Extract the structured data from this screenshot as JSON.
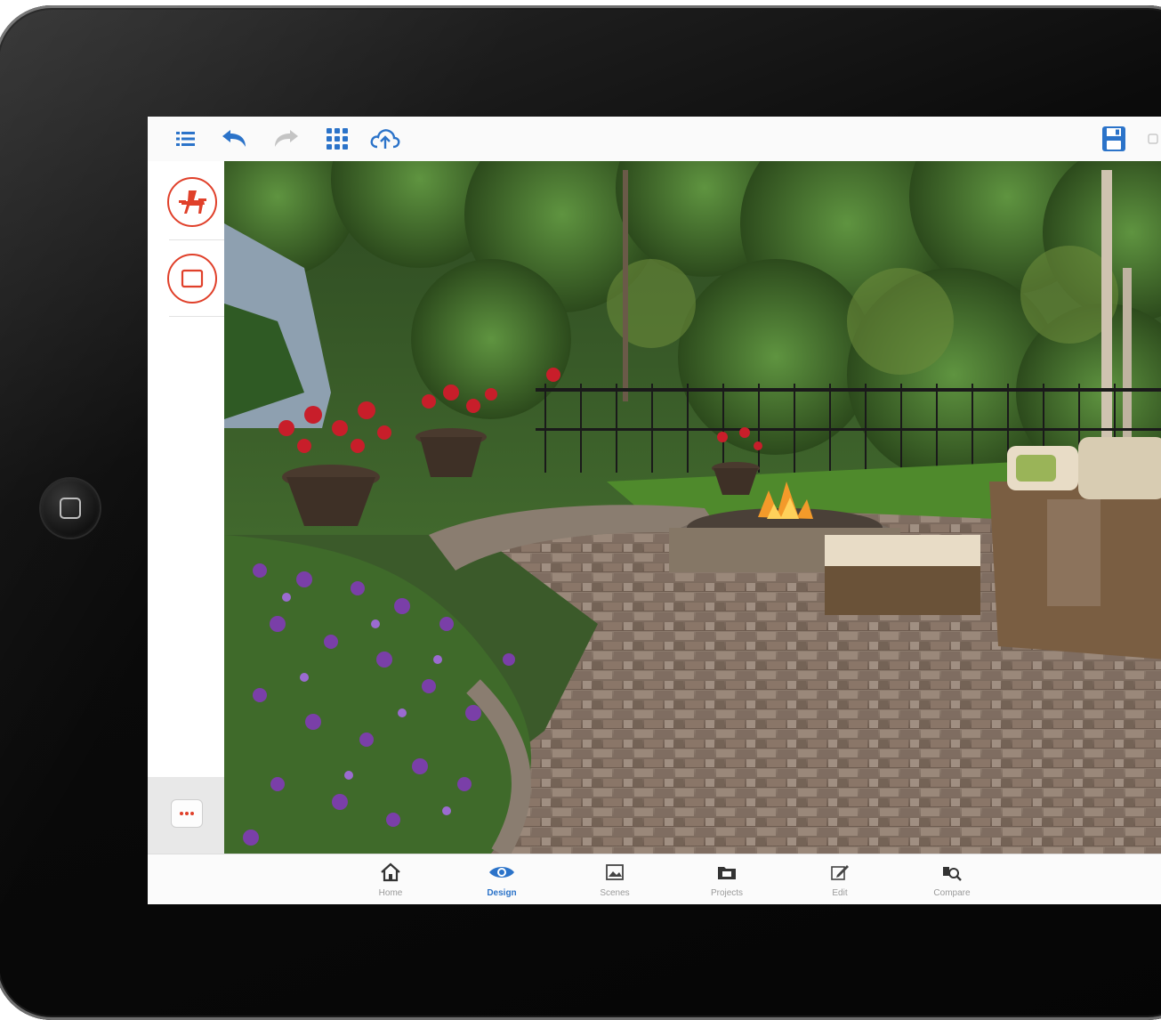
{
  "toolbar": {
    "left_icons": [
      "list-icon",
      "undo-icon",
      "redo-icon",
      "grid-icon",
      "cloud-upload-icon"
    ],
    "right_icons": [
      "save-icon"
    ]
  },
  "sidebar": {
    "tools": [
      "chair-icon",
      "rectangle-icon"
    ],
    "more_icon": "more-dots-icon"
  },
  "tabs": [
    {
      "label": "Home",
      "icon": "home-icon",
      "active": false
    },
    {
      "label": "Design",
      "icon": "eye-icon",
      "active": true
    },
    {
      "label": "Scenes",
      "icon": "image-icon",
      "active": false
    },
    {
      "label": "Projects",
      "icon": "folder-icon",
      "active": false
    },
    {
      "label": "Edit",
      "icon": "pencil-icon",
      "active": false
    },
    {
      "label": "Compare",
      "icon": "compare-icon",
      "active": false
    }
  ],
  "colors": {
    "accent_blue": "#2b73c9",
    "tool_red": "#e0402a",
    "device_black": "#0b0b0b"
  }
}
